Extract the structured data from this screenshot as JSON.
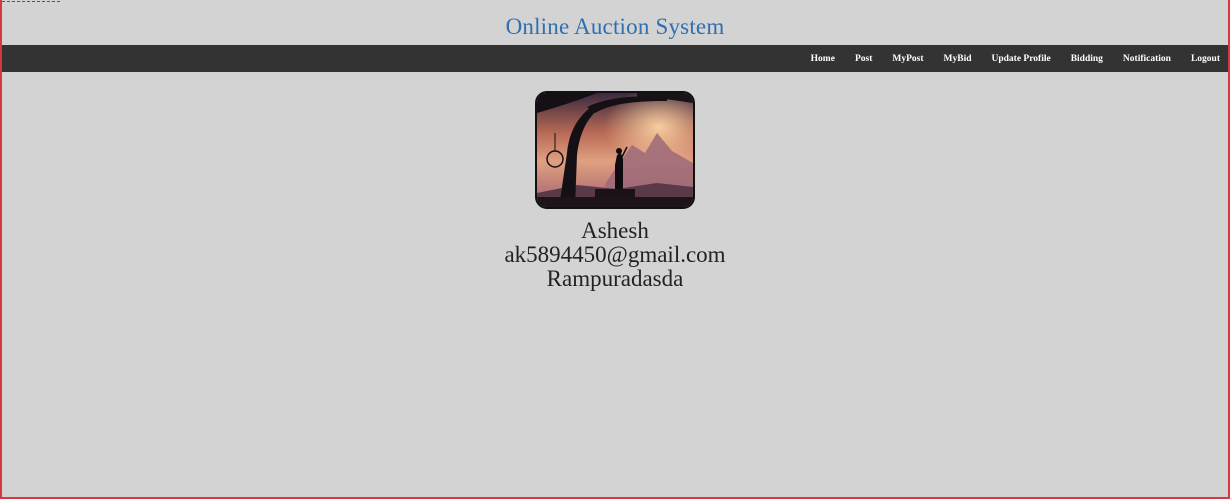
{
  "header": {
    "title": "Online Auction System"
  },
  "nav": {
    "items": [
      "Home",
      "Post",
      "MyPost",
      "MyBid",
      "Update Profile",
      "Bidding",
      "Notification",
      "Logout"
    ]
  },
  "profile": {
    "name": "Ashesh",
    "email": "ak5894450@gmail.com",
    "address": "Rampuradasda"
  },
  "colors": {
    "background": "#d3d3d3",
    "navbar": "#333333",
    "title": "#2f6fb0",
    "border": "#d9363e"
  }
}
